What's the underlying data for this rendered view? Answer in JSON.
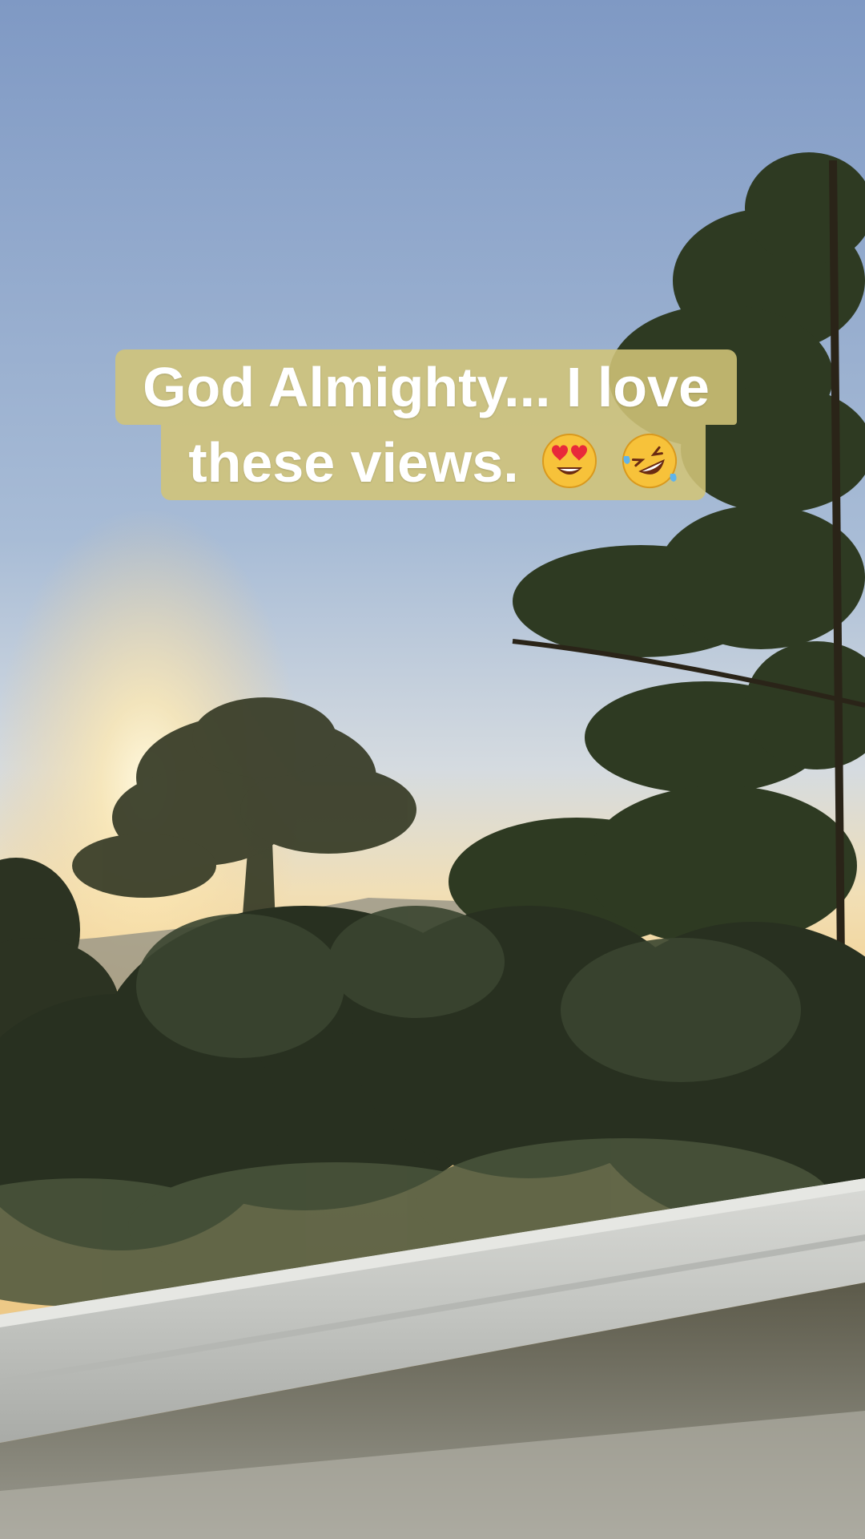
{
  "caption": {
    "line1": "God Almighty... I love",
    "line2": "these views.",
    "emojis": [
      "smiling-face-with-heart-eyes-icon",
      "rolling-on-floor-laughing-icon"
    ]
  },
  "colors": {
    "sky_top": "#7f99c4",
    "sky_horizon": "#f4d79a",
    "caption_bg": "#d2c478",
    "caption_text": "#ffffff",
    "foliage": "#2f3a24"
  }
}
